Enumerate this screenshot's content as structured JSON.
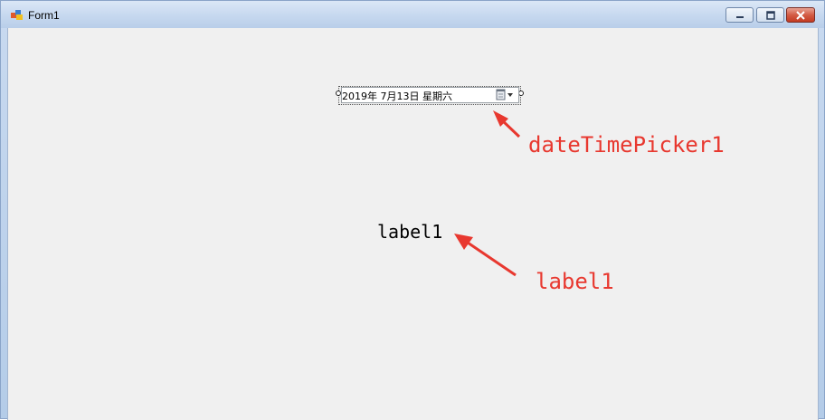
{
  "window": {
    "title": "Form1",
    "buttons": {
      "minimize": "minimize",
      "maximize": "maximize",
      "close": "close"
    }
  },
  "form": {
    "date_time_picker": {
      "value": "2019年  7月13日  星期六"
    },
    "label": {
      "text": "label1"
    }
  },
  "annotations": {
    "date_time_picker": "dateTimePicker1",
    "label": "label1"
  },
  "colors": {
    "annotation": "#e8382f",
    "client_background": "#f0f0f0",
    "titlebar": "#c6d8ef"
  },
  "icons": [
    "app-icon",
    "minimize-icon",
    "maximize-icon",
    "close-icon",
    "calendar-icon",
    "dropdown-arrow-icon",
    "arrow-icon"
  ]
}
